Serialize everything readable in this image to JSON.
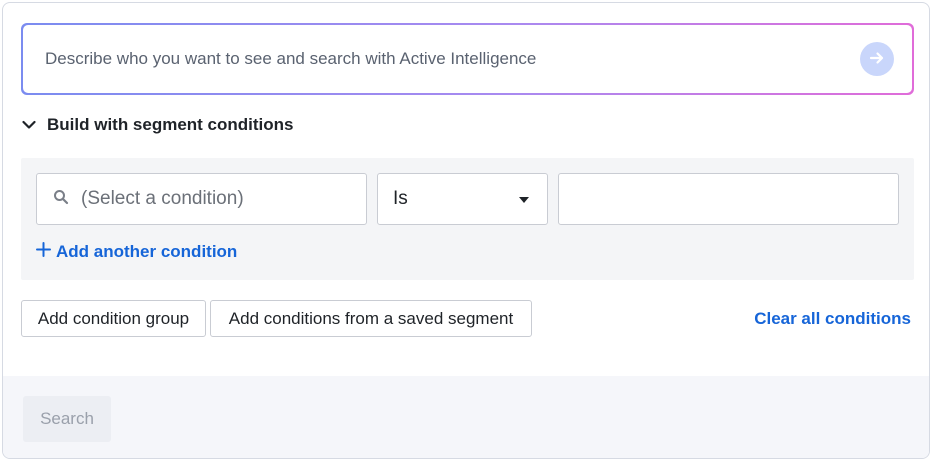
{
  "ai_search": {
    "placeholder": "Describe who you want to see and search with Active Intelligence",
    "submit_icon": "arrow-right-icon"
  },
  "section": {
    "title": "Build with segment conditions",
    "expanded": true
  },
  "condition": {
    "field_placeholder": "(Select a condition)",
    "operator_value": "Is",
    "value": ""
  },
  "actions": {
    "add_another_condition": "Add another condition",
    "add_condition_group": "Add condition group",
    "add_from_saved_segment": "Add conditions from a saved segment",
    "clear_all": "Clear all conditions"
  },
  "footer": {
    "search_label": "Search",
    "search_enabled": false
  },
  "colors": {
    "accent": "#1665d8",
    "gradient_start": "#7b8cf0",
    "gradient_end": "#e06cd9",
    "submit_bg": "#c9d6fb"
  }
}
